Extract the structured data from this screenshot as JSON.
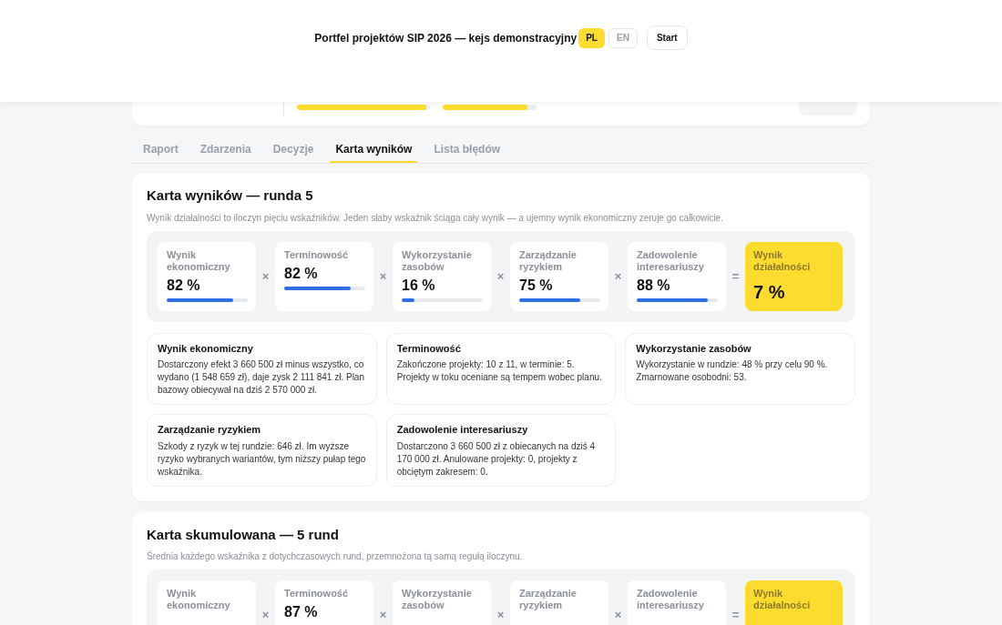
{
  "header": {
    "title": "Portfel projektów SIP 2026 — kejs demonstracyjny",
    "languages": [
      {
        "label": "PL",
        "selected": true
      },
      {
        "label": "EN",
        "selected": false
      }
    ],
    "start_button": "Start"
  },
  "summary_card": {
    "bars": [
      {
        "level": 0.97
      },
      {
        "level": 0.9
      }
    ]
  },
  "tabs": [
    {
      "label": "Raport",
      "selected": false
    },
    {
      "label": "Zdarzenia",
      "selected": false
    },
    {
      "label": "Decyzje",
      "selected": false
    },
    {
      "label": "Karta wyników",
      "selected": true
    },
    {
      "label": "Lista błędów",
      "selected": false
    }
  ],
  "scorecards": [
    {
      "title": "Karta wyników — runda 5",
      "description": "Wynik działalności to iloczyn pięciu wskaźników. Jeden słaby wskaźnik ściąga cały wynik — a ujemny wynik ekonomiczny zeruje go całkowicie.",
      "metrics": [
        {
          "label": "Wynik ekonomiczny",
          "value": "82 %",
          "level": 0.82,
          "operator": "×"
        },
        {
          "label": "Terminowość",
          "value": "82 %",
          "level": 0.82,
          "operator": "×"
        },
        {
          "label": "Wykorzystanie zasobów",
          "value": "16 %",
          "level": 0.16,
          "operator": "×"
        },
        {
          "label": "Zarządzanie ryzykiem",
          "value": "75 %",
          "level": 0.75,
          "operator": "×"
        },
        {
          "label": "Zadowolenie interesariuszy",
          "value": "88 %",
          "level": 0.88,
          "operator": "="
        }
      ],
      "result": {
        "label": "Wynik działalności",
        "value": "7 %"
      },
      "details": [
        {
          "title": "Wynik ekonomiczny",
          "text": "Dostarczony efekt 3 660 500 zł minus wszystko, co wydano (1 548 659 zł), daje zysk 2 111 841 zł. Plan bazowy obiecywał na dziś 2 570 000 zł."
        },
        {
          "title": "Terminowość",
          "text": "Zakończone projekty: 10 z 11, w terminie: 5. Projekty w toku oceniane są tempem wobec planu."
        },
        {
          "title": "Wykorzystanie zasobów",
          "text": "Wykorzystanie w rundzie: 48 % przy celu 90 %. Zmarnowane osobodni: 53."
        },
        {
          "title": "Zarządzanie ryzykiem",
          "text": "Szkody z ryzyk w tej rundzie: 646 zł. Im wyższe ryzyko wybranych wariantów, tym niższy pułap tego wskaźnika."
        },
        {
          "title": "Zadowolenie interesariuszy",
          "text": "Dostarczono 3 660 500 zł z obiecanych na dziś 4 170 000 zł. Anulowane projekty: 0, projekty z obciętym zakresem: 0."
        }
      ]
    },
    {
      "title": "Karta skumulowana — 5 rund",
      "description": "Średnia każdego wskaźnika z dotychczasowych rund, przemnożona tą samą regułą iloczynu.",
      "metrics": [
        {
          "label": "Wynik ekonomiczny",
          "operator": "×"
        },
        {
          "label": "Terminowość",
          "value": "87 %",
          "operator": "×"
        },
        {
          "label": "Wykorzystanie zasobów",
          "operator": "×"
        },
        {
          "label": "Zarządzanie ryzykiem",
          "operator": "×"
        },
        {
          "label": "Zadowolenie interesariuszy",
          "operator": "="
        }
      ],
      "result": {
        "label": "Wynik działalności"
      }
    }
  ]
}
